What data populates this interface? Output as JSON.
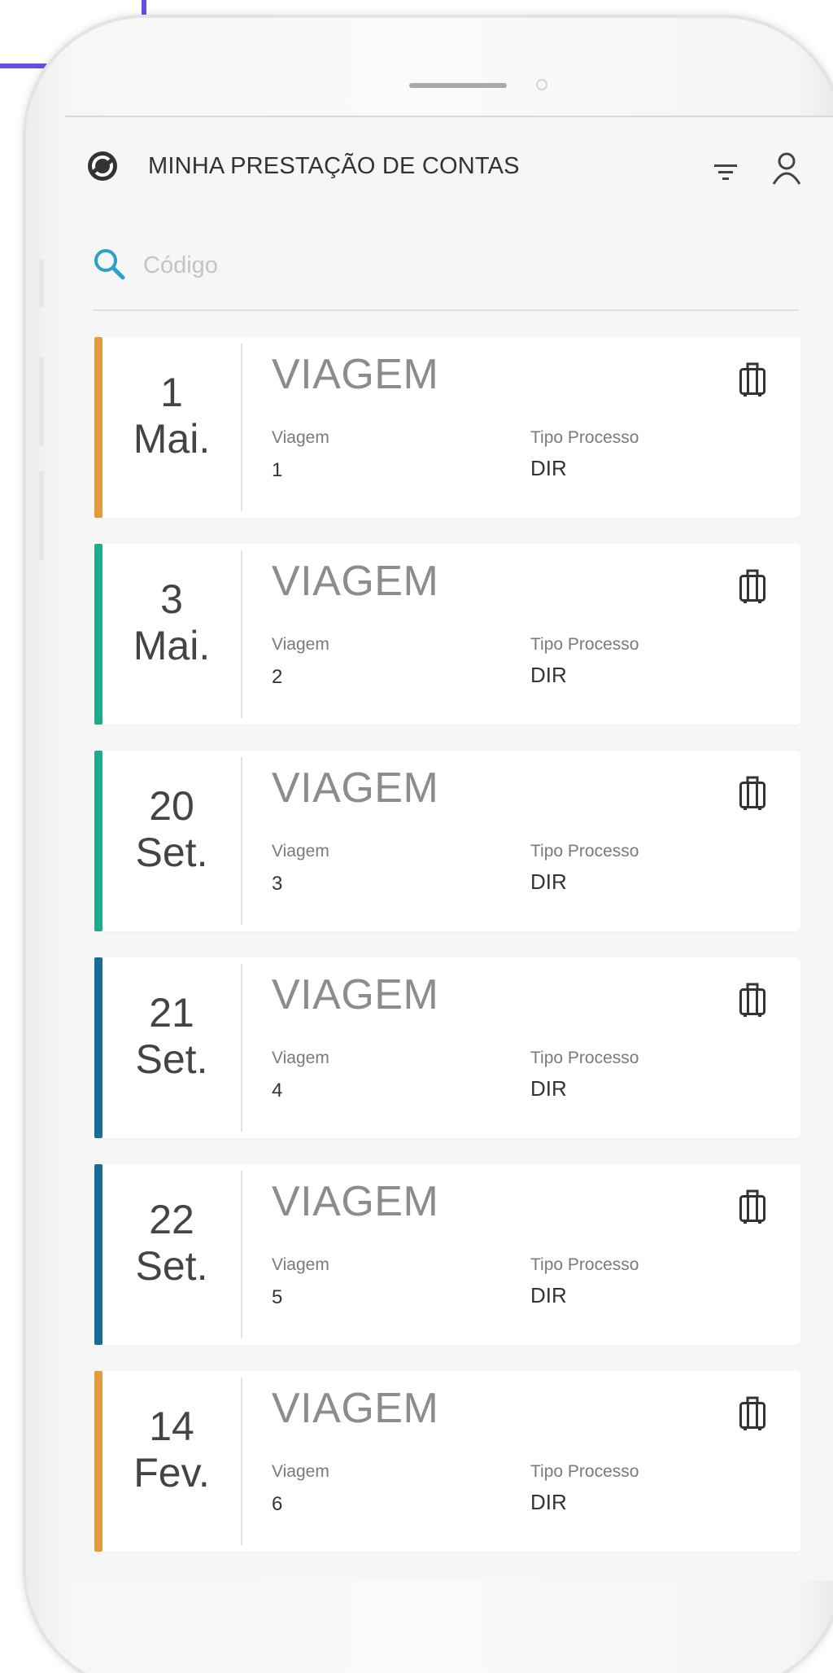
{
  "header": {
    "title": "MINHA PRESTAÇÃO DE CONTAS",
    "logo_icon": "refresh-circle-icon",
    "filter_icon": "filter-icon",
    "user_icon": "user-icon"
  },
  "search": {
    "placeholder": "Código",
    "value": "",
    "icon": "search-icon"
  },
  "colors": {
    "orange": "#e59a3c",
    "green": "#1fab89",
    "blue": "#1a6b96",
    "search_accent": "#2aa1c6",
    "badge_border": "#6a4de8"
  },
  "cards": [
    {
      "day": "1",
      "month": "Mai.",
      "type": "VIAGEM",
      "viagem_label": "Viagem",
      "viagem_value": "1",
      "tipo_label": "Tipo Processo",
      "tipo_value": "DIR",
      "accent": "#e59a3c",
      "icon": "luggage-icon"
    },
    {
      "day": "3",
      "month": "Mai.",
      "type": "VIAGEM",
      "viagem_label": "Viagem",
      "viagem_value": "2",
      "tipo_label": "Tipo Processo",
      "tipo_value": "DIR",
      "accent": "#1fab89",
      "icon": "luggage-icon"
    },
    {
      "day": "20",
      "month": "Set.",
      "type": "VIAGEM",
      "viagem_label": "Viagem",
      "viagem_value": "3",
      "tipo_label": "Tipo Processo",
      "tipo_value": "DIR",
      "accent": "#1fab89",
      "icon": "luggage-icon"
    },
    {
      "day": "21",
      "month": "Set.",
      "type": "VIAGEM",
      "viagem_label": "Viagem",
      "viagem_value": "4",
      "tipo_label": "Tipo Processo",
      "tipo_value": "DIR",
      "accent": "#1a6b96",
      "icon": "luggage-icon"
    },
    {
      "day": "22",
      "month": "Set.",
      "type": "VIAGEM",
      "viagem_label": "Viagem",
      "viagem_value": "5",
      "tipo_label": "Tipo Processo",
      "tipo_value": "DIR",
      "accent": "#1a6b96",
      "icon": "luggage-icon"
    },
    {
      "day": "14",
      "month": "Fev.",
      "type": "VIAGEM",
      "viagem_label": "Viagem",
      "viagem_value": "6",
      "tipo_label": "Tipo Processo",
      "tipo_value": "DIR",
      "accent": "#e59a3c",
      "icon": "luggage-icon"
    }
  ]
}
